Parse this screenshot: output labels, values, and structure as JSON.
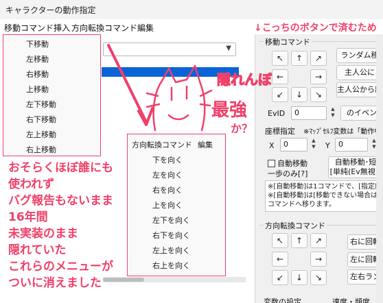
{
  "window": {
    "title": "キャラクターの動作指定"
  },
  "menubar": {
    "move_insert": "移動コマンド挿入",
    "dir_change": "方向転換コマンド",
    "edit": "編集"
  },
  "dropdown_move": {
    "items": [
      "下移動",
      "左移動",
      "右移動",
      "上移動",
      "左下移動",
      "右下移動",
      "左上移動",
      "右上移動"
    ]
  },
  "dropdown_dir": {
    "header": "方向転換コマンド",
    "header_edit": "編集",
    "items": [
      "下を向く",
      "左を向く",
      "右を向く",
      "上を向く",
      "左下を向く",
      "右下を向く",
      "左上を向く",
      "右上を向く"
    ]
  },
  "right_panel": {
    "move_group_label": "移動コマンド",
    "arrows": {
      "ul": "↖",
      "up": "↑",
      "ur": "↗",
      "left": "←",
      "right": "→",
      "dl": "↙",
      "down": "↓",
      "dr": "↘"
    },
    "random_move": "ランダム移",
    "toward_hero": "主人公に",
    "away_hero": "主人公から離",
    "evid_label": "EvID",
    "evid_value": "0",
    "event_button": "のイベン",
    "coord_label": "座標指定",
    "coord_note": "※ﾏｯﾌﾟｾﾙﾌ変数は「動作中",
    "x_label": "X",
    "x_value": "0",
    "y_label": "Y",
    "y_value": "0",
    "auto_move_check": "自動移動",
    "one_step_only": "一歩のみ[?]",
    "auto_short_1": "自動移動･短",
    "auto_short_2": "[単純(Ev無視)]",
    "info_1": "※[自動移動]は1コマンドで、[指定座",
    "info_2": "※[自動移動]は[移動できない場合は",
    "info_3": "コマンドへ移ります。",
    "dir_group_label": "方向転換コマンド",
    "turn_right": "右に回転",
    "turn_left": "左に回転",
    "random_dir": "左右ラン",
    "var_label": "変数の設定",
    "speed_label": "速度・頻度"
  },
  "annotations": {
    "top_note": "↓こっちのボタンで済むため",
    "hidden_1": "隠れんぼ",
    "hidden_2": "最強",
    "hidden_3": "か？",
    "message": [
      "おそらくほぼ誰にも",
      "使われず",
      "バグ報告もないまま",
      "16年間",
      "未実装のまま",
      "隠れていた",
      "これらのメニューが",
      "ついに消えました"
    ]
  },
  "colors": {
    "accent": "#f0406a",
    "selection": "#0a64d8"
  }
}
